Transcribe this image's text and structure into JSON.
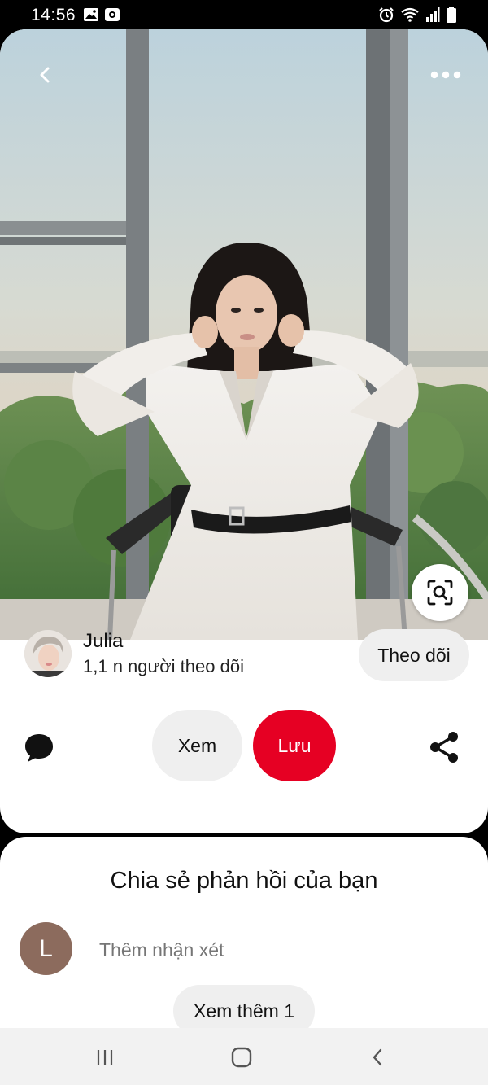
{
  "status_bar": {
    "time": "14:56",
    "icons": [
      "gallery-icon",
      "screen-record-icon",
      "alarm-icon",
      "wifi-icon",
      "signal-icon",
      "battery-icon"
    ]
  },
  "pin": {
    "icons": [
      "back-arrow-icon",
      "more-dots-icon",
      "visual-search-icon"
    ]
  },
  "creator": {
    "name": "Julia",
    "followers": "1,1 n người theo dõi",
    "follow_label": "Theo dõi"
  },
  "actions": {
    "view_label": "Xem",
    "save_label": "Lưu",
    "save_color": "#e60023",
    "icons": [
      "comment-bubble-icon",
      "share-icon"
    ]
  },
  "comments": {
    "title": "Chia sẻ phản hồi của bạn",
    "avatar_letter": "L",
    "avatar_color": "#8c6b5d",
    "placeholder": "Thêm nhận xét",
    "see_more_label": "Xem thêm 1"
  },
  "nav_bar": {
    "icons": [
      "recent-apps-icon",
      "home-icon",
      "back-icon"
    ]
  }
}
